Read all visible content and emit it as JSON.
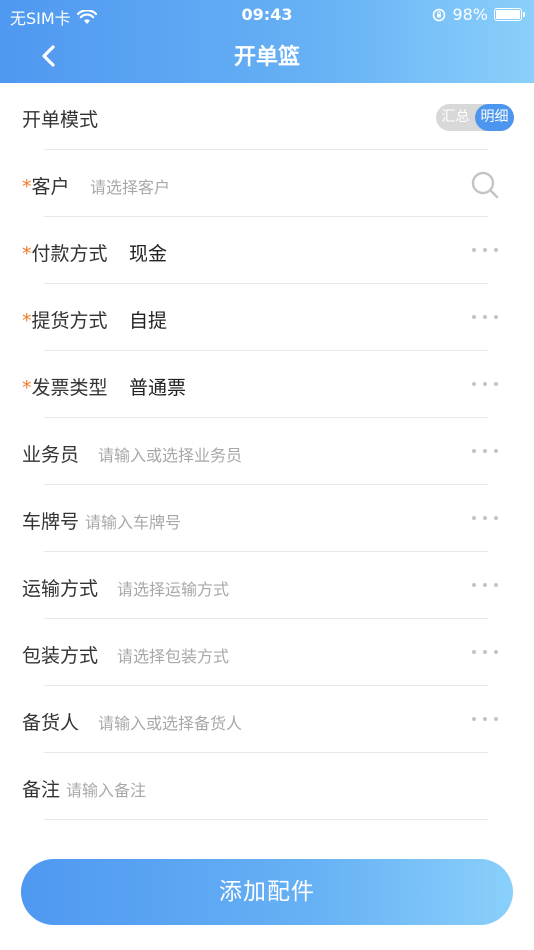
{
  "status_bar": {
    "carrier": "无SIM卡",
    "time": "09:43",
    "battery": "98%",
    "battery_level": 0.98
  },
  "header": {
    "title": "开单篮",
    "back_icon": "chevron-left-icon"
  },
  "mode": {
    "label": "开单模式",
    "options": [
      "汇总",
      "明细"
    ],
    "selected": "明细"
  },
  "fields": [
    {
      "label": "客户",
      "required": "*",
      "placeholder": "请选择客户",
      "icon": "search-icon"
    },
    {
      "label": "付款方式",
      "required": "*",
      "value": "现金",
      "icon": "more-icon"
    },
    {
      "label": "提货方式",
      "required": "*",
      "value": "自提",
      "icon": "more-icon"
    },
    {
      "label": "发票类型",
      "required": "*",
      "value": "普通票",
      "icon": "more-icon"
    },
    {
      "label": "业务员",
      "placeholder": "请输入或选择业务员",
      "icon": "more-icon"
    },
    {
      "label": "车牌号",
      "placeholder": "请输入车牌号",
      "icon": "more-icon"
    },
    {
      "label": "运输方式",
      "placeholder": "请选择运输方式",
      "icon": "more-icon"
    },
    {
      "label": "包装方式",
      "placeholder": "请选择包装方式",
      "icon": "more-icon"
    },
    {
      "label": "备货人",
      "placeholder": "请输入或选择备货人",
      "icon": "more-icon"
    },
    {
      "label": "备注",
      "placeholder": "请输入备注"
    }
  ],
  "actions": {
    "add_label": "添加配件"
  },
  "colors": {
    "accent": "#4c96ef",
    "required": "#f07b2a",
    "placeholder": "#a8a8a8"
  }
}
